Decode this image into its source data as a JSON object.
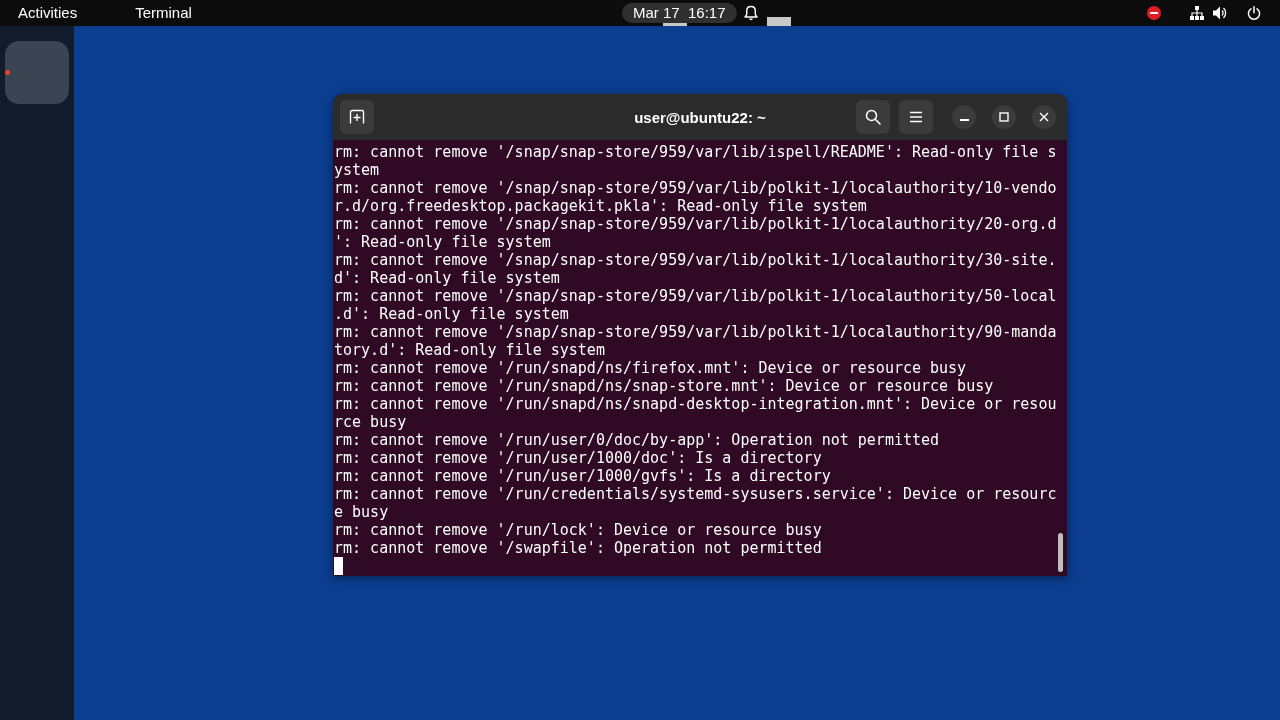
{
  "top_bar": {
    "activities": "Activities",
    "app_menu": "Terminal",
    "clock": "Mar 17  16:17"
  },
  "dock": {
    "apps": [
      {
        "running": true
      }
    ]
  },
  "terminal": {
    "title": "user@ubuntu22: ~",
    "lines": [
      "rm: cannot remove '/snap/snap-store/959/var/lib/ispell/README': Read-only file system",
      "rm: cannot remove '/snap/snap-store/959/var/lib/polkit-1/localauthority/10-vendor.d/org.freedesktop.packagekit.pkla': Read-only file system",
      "rm: cannot remove '/snap/snap-store/959/var/lib/polkit-1/localauthority/20-org.d': Read-only file system",
      "rm: cannot remove '/snap/snap-store/959/var/lib/polkit-1/localauthority/30-site.d': Read-only file system",
      "rm: cannot remove '/snap/snap-store/959/var/lib/polkit-1/localauthority/50-local.d': Read-only file system",
      "rm: cannot remove '/snap/snap-store/959/var/lib/polkit-1/localauthority/90-mandatory.d': Read-only file system",
      "rm: cannot remove '/run/snapd/ns/firefox.mnt': Device or resource busy",
      "rm: cannot remove '/run/snapd/ns/snap-store.mnt': Device or resource busy",
      "rm: cannot remove '/run/snapd/ns/snapd-desktop-integration.mnt': Device or resource busy",
      "rm: cannot remove '/run/user/0/doc/by-app': Operation not permitted",
      "rm: cannot remove '/run/user/1000/doc': Is a directory",
      "rm: cannot remove '/run/user/1000/gvfs': Is a directory",
      "rm: cannot remove '/run/credentials/systemd-sysusers.service': Device or resource busy",
      "rm: cannot remove '/run/lock': Device or resource busy",
      "rm: cannot remove '/swapfile': Operation not permitted"
    ]
  }
}
